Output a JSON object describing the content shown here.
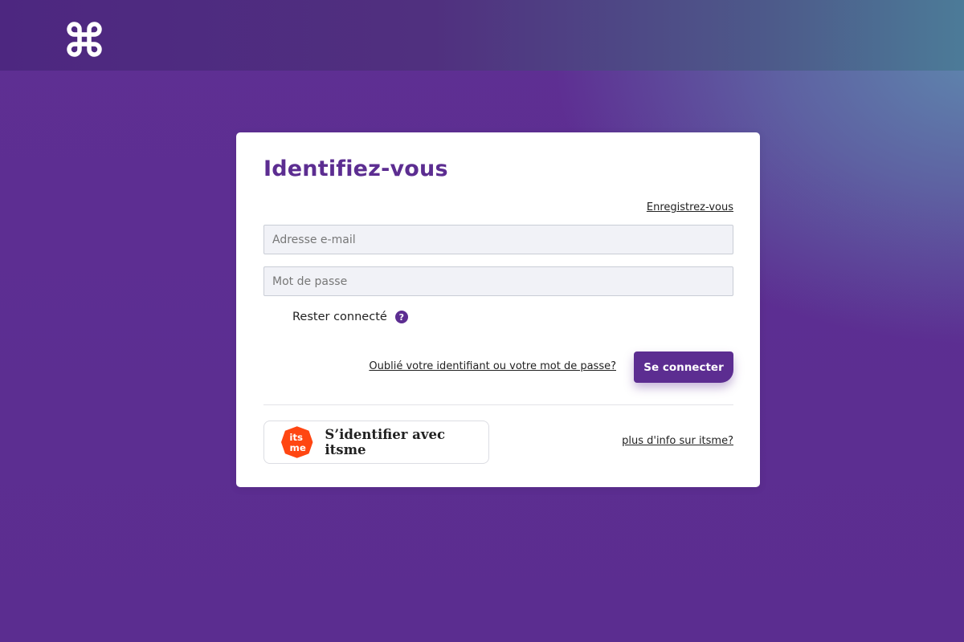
{
  "header": {
    "logo_icon": "command-key-icon"
  },
  "login": {
    "title": "Identifiez-vous",
    "register_link": "Enregistrez-vous",
    "email_placeholder": "Adresse e-mail",
    "email_value": "",
    "password_placeholder": "Mot de passe",
    "password_value": "",
    "remember_label": "Rester connecté",
    "help_icon": "question-circle-icon",
    "forgot_link": "Oublié votre identifiant ou votre mot de passe?",
    "submit_label": "Se connecter"
  },
  "itsme": {
    "button_label": "S’identifier avec itsme",
    "logo_text_top": "its",
    "logo_text_bottom": "me",
    "info_link": "plus d'info sur itsme?"
  },
  "colors": {
    "brand": "#5c2d91",
    "itsme": "#ff4612"
  }
}
